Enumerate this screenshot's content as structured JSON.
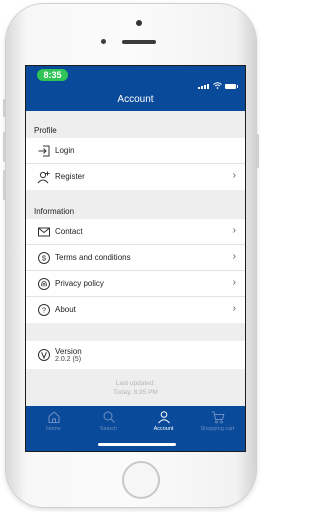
{
  "status_bar": {
    "time": "8:35"
  },
  "header": {
    "title": "Account"
  },
  "sections": {
    "profile": {
      "label": "Profile",
      "items": [
        {
          "label": "Login",
          "icon": "login-icon"
        },
        {
          "label": "Register",
          "icon": "add-user-icon"
        }
      ]
    },
    "information": {
      "label": "Information",
      "items": [
        {
          "label": "Contact",
          "icon": "envelope-icon"
        },
        {
          "label": "Terms and conditions",
          "icon": "dollar-circle-icon"
        },
        {
          "label": "Privacy policy",
          "icon": "fingerprint-icon"
        },
        {
          "label": "About",
          "icon": "question-circle-icon"
        }
      ]
    },
    "version": {
      "title": "Version",
      "value": "2.0.2 (5)",
      "icon": "version-icon"
    }
  },
  "last_updated": {
    "label": "Last updated:",
    "value": "Today, 8:35 PM"
  },
  "tabs": [
    {
      "label": "Home",
      "icon": "home-icon",
      "active": false
    },
    {
      "label": "Search",
      "icon": "search-icon",
      "active": false
    },
    {
      "label": "Account",
      "icon": "person-icon",
      "active": true
    },
    {
      "label": "Shopping cart",
      "icon": "cart-icon",
      "active": false
    }
  ],
  "colors": {
    "brand": "#0a4a9b",
    "status_pill": "#2fc455",
    "inactive_tab": "#6f8fbf"
  }
}
